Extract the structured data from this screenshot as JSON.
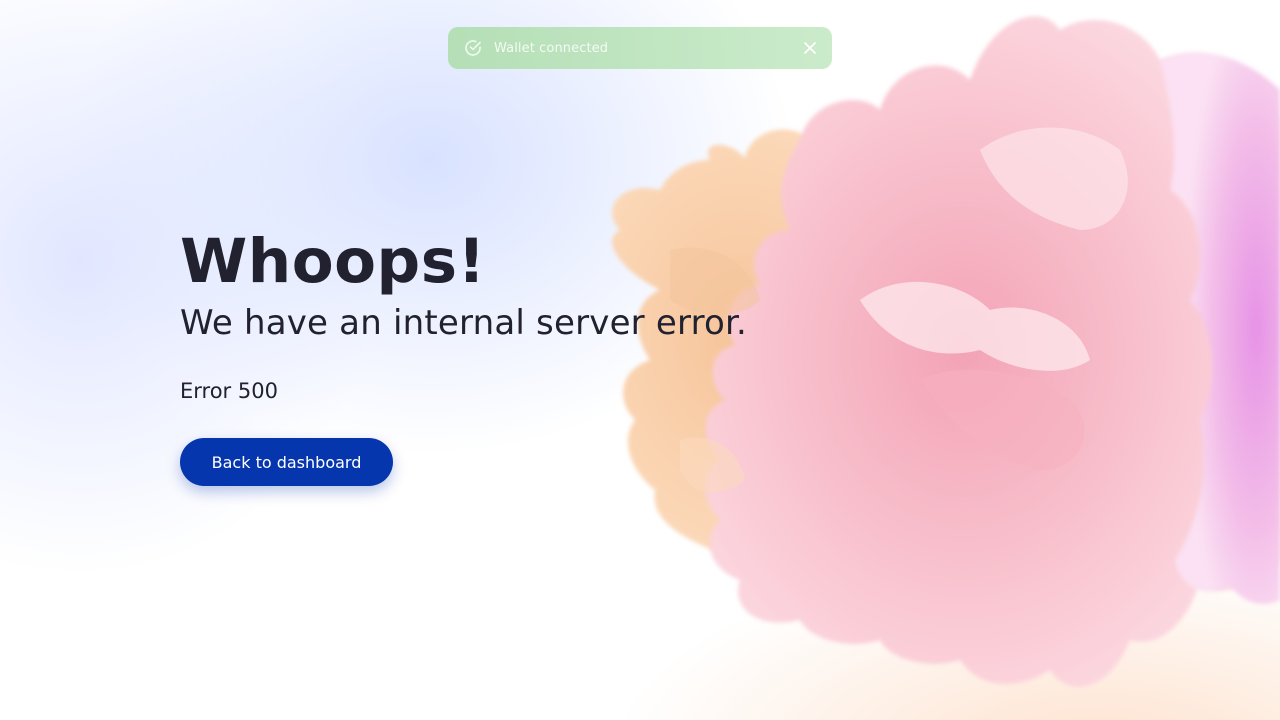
{
  "toast": {
    "message": "Wallet connected",
    "status_icon": "check-circle-icon",
    "close_icon": "close-icon",
    "color": "#b7e0b7"
  },
  "error": {
    "title": "Whoops!",
    "subtitle": "We have an internal server error.",
    "code": "Error 500"
  },
  "actions": {
    "back_label": "Back to dashboard",
    "button_color": "#0636ad"
  },
  "colors": {
    "text": "#22212f",
    "background_tint": "#dfe6ff",
    "blob_peach": "#f9cda4",
    "blob_pink": "#f7b6c6",
    "blob_magenta": "#e9a0e6"
  }
}
